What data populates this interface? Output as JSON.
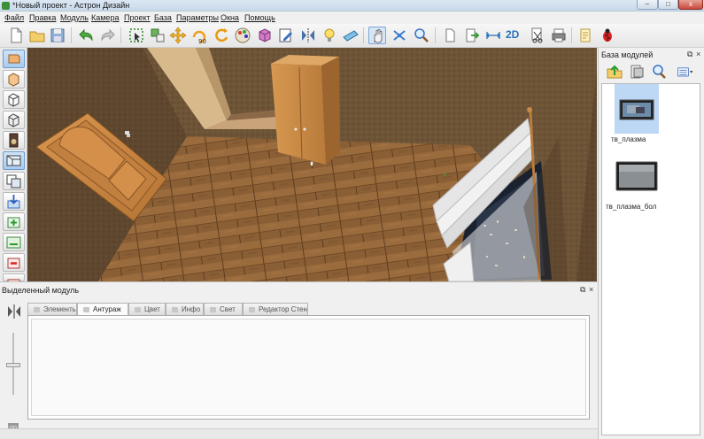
{
  "window": {
    "title": "*Новый проект - Астрон Дизайн",
    "minimize_glyph": "–",
    "maximize_glyph": "□",
    "close_glyph": "x"
  },
  "menu": {
    "items": [
      "Файл",
      "Правка",
      "Модуль",
      "Камера",
      "Проект",
      "База",
      "Параметры",
      "Окна",
      "Помощь"
    ]
  },
  "toolbar": {
    "label_2d": "2D",
    "icons": [
      "new-file-icon",
      "open-folder-icon",
      "save-icon",
      "undo-icon",
      "redo-icon",
      "select-frame-icon",
      "select-add-icon",
      "move-icon",
      "rotate-90-icon",
      "rotate-icon",
      "color-palette-icon",
      "cube-texture-icon",
      "edit-module-icon",
      "mirror-icon",
      "light-bulb-icon",
      "ruler-icon",
      "hand-pan-icon",
      "orbit-icon",
      "zoom-icon",
      "doc-icon",
      "export-icon",
      "dimension-icon",
      "view-2d-icon",
      "scissors-icon",
      "print-icon",
      "notes-icon",
      "bug-icon"
    ],
    "active": "hand-pan-icon"
  },
  "left_toolbar": {
    "icons": [
      "wall-tool-icon",
      "box-tool-icon",
      "box-outline-icon",
      "box-open-icon",
      "speaker-icon",
      "view-perspective-icon",
      "view-duplicate-icon",
      "import-icon",
      "plus-green-icon",
      "add-area-icon",
      "delete-red-icon",
      "remove-red-icon"
    ],
    "active": "wall-tool-icon"
  },
  "module_base": {
    "title": "База модулей",
    "dock_glyph": "⧉",
    "close_glyph": "×",
    "items": [
      {
        "label": "тв_плазма",
        "selected": true
      },
      {
        "label": "тв_плазма_бол",
        "selected": false
      }
    ]
  },
  "selected_module": {
    "title": "Выделенный модуль",
    "dock_glyph": "⧉",
    "close_glyph": "×",
    "tabs": [
      {
        "label": "Элементы",
        "selected": false
      },
      {
        "label": "Антураж",
        "selected": true
      },
      {
        "label": "Цвет",
        "selected": false
      },
      {
        "label": "Инфо",
        "selected": false
      },
      {
        "label": "Свет",
        "selected": false
      },
      {
        "label": "Редактор Стен",
        "selected": false
      }
    ]
  },
  "colors": {
    "wall": "#6b5236",
    "floor": "#8a5e33",
    "wood_furniture": "#c98a48",
    "selection_blue": "#bcd8f5"
  }
}
